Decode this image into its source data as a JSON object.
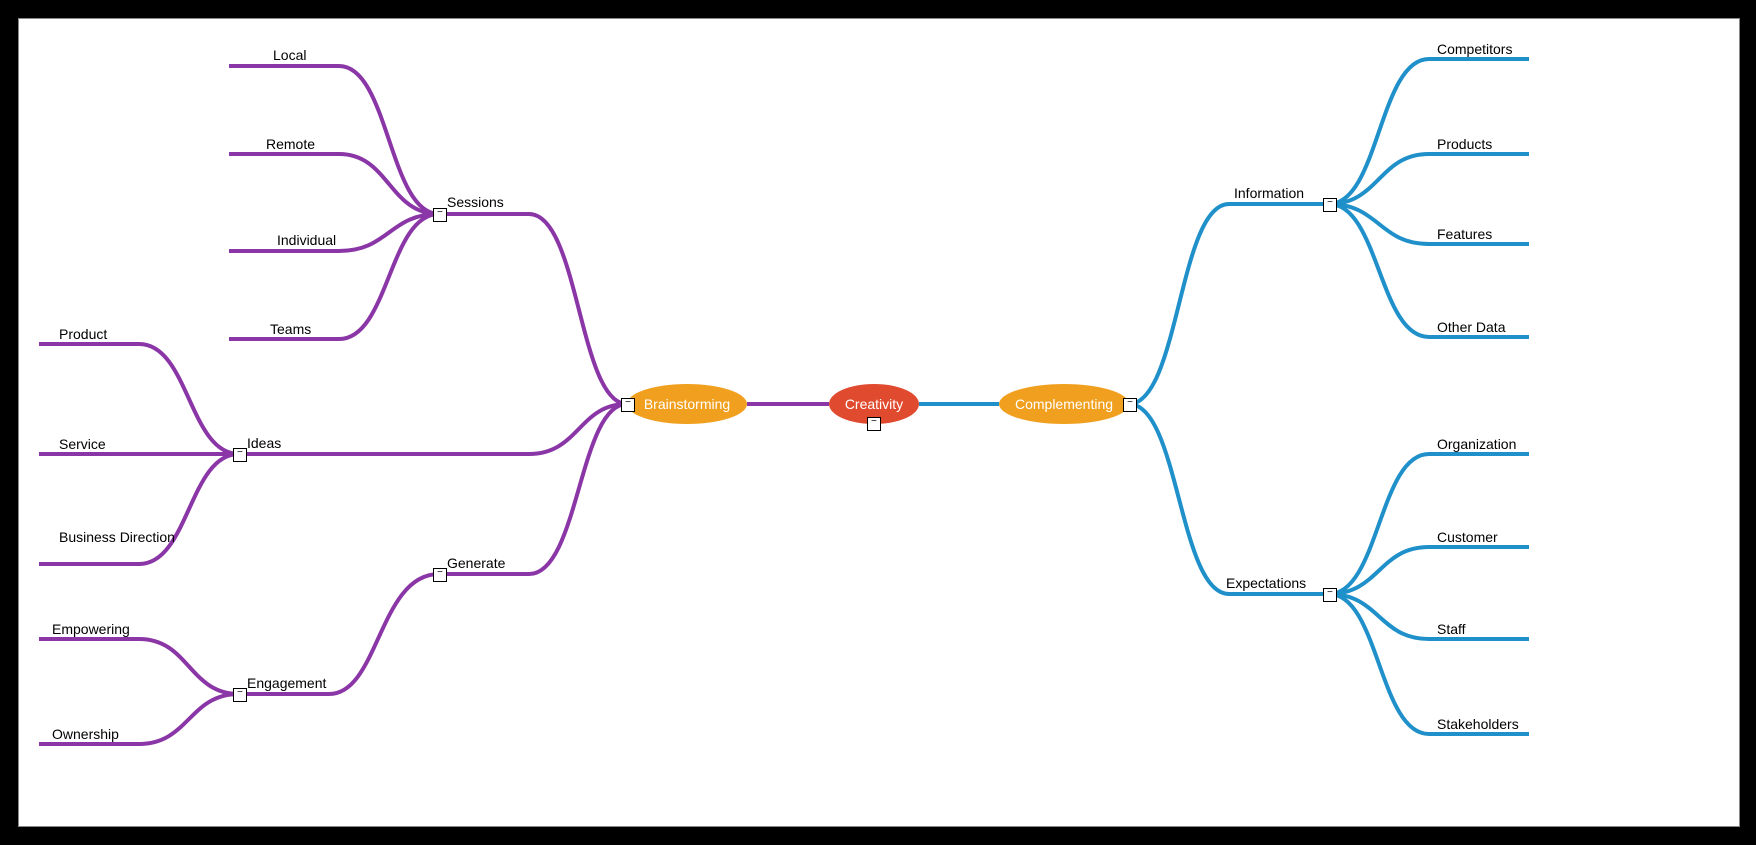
{
  "colors": {
    "left": "#8b36a6",
    "right": "#1f90c9",
    "root": "#e04a2e",
    "branch": "#f0a01e"
  },
  "root": {
    "label": "Creativity"
  },
  "left": {
    "main": "Brainstorming",
    "branches": [
      {
        "label": "Sessions",
        "leaves": [
          "Local",
          "Remote",
          "Individual",
          "Teams"
        ]
      },
      {
        "label": "Ideas",
        "leaves": [
          "Product",
          "Service",
          "Business Direction"
        ]
      },
      {
        "label": "Generate",
        "leaves": []
      },
      {
        "label": "Engagement",
        "leaves": [
          "Empowering",
          "Ownership"
        ]
      }
    ]
  },
  "right": {
    "main": "Complementing",
    "branches": [
      {
        "label": "Information",
        "leaves": [
          "Competitors",
          "Products",
          "Features",
          "Other Data"
        ]
      },
      {
        "label": "Expectations",
        "leaves": [
          "Organization",
          "Customer",
          "Staff",
          "Stakeholders"
        ]
      }
    ]
  },
  "labels": {
    "sessions": "Sessions",
    "ideas": "Ideas",
    "generate": "Generate",
    "engagement": "Engagement",
    "local": "Local",
    "remote": "Remote",
    "individual": "Individual",
    "teams": "Teams",
    "product": "Product",
    "service": "Service",
    "bizdir": "Business Direction",
    "empowering": "Empowering",
    "ownership": "Ownership",
    "information": "Information",
    "expectations": "Expectations",
    "competitors": "Competitors",
    "products": "Products",
    "features": "Features",
    "otherdata": "Other Data",
    "organization": "Organization",
    "customer": "Customer",
    "staff": "Staff",
    "stakeholders": "Stakeholders"
  }
}
